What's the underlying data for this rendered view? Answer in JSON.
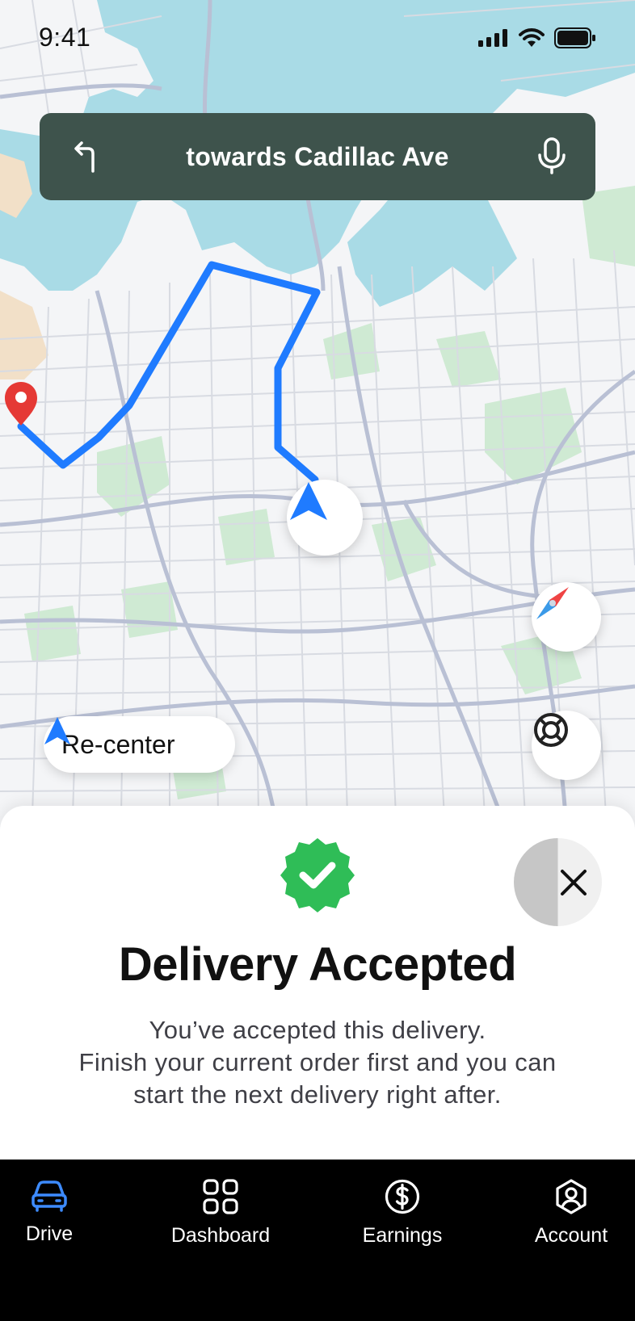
{
  "status_bar": {
    "time": "9:41"
  },
  "navigation": {
    "instruction": "towards Cadillac Ave",
    "turn_icon": "turn-left-icon",
    "mic_icon": "microphone-icon"
  },
  "map": {
    "recenter_label": "Re-center",
    "route_color": "#1f7bff",
    "destination_pin_color": "#e53935",
    "water_color": "#a9dbe6",
    "park_color": "#cfead3"
  },
  "sheet": {
    "title": "Delivery Accepted",
    "message_lines": [
      "You’ve accepted this delivery.",
      "Finish your current order first and you can",
      "start the next delivery right after."
    ],
    "badge_color": "#2fbd57"
  },
  "tabbar": {
    "tabs": [
      {
        "label": "Drive",
        "icon": "car-icon",
        "active": true
      },
      {
        "label": "Dashboard",
        "icon": "grid-icon",
        "active": false
      },
      {
        "label": "Earnings",
        "icon": "dollar-icon",
        "active": false
      },
      {
        "label": "Account",
        "icon": "user-icon",
        "active": false
      }
    ],
    "active_color": "#3d8bff"
  }
}
